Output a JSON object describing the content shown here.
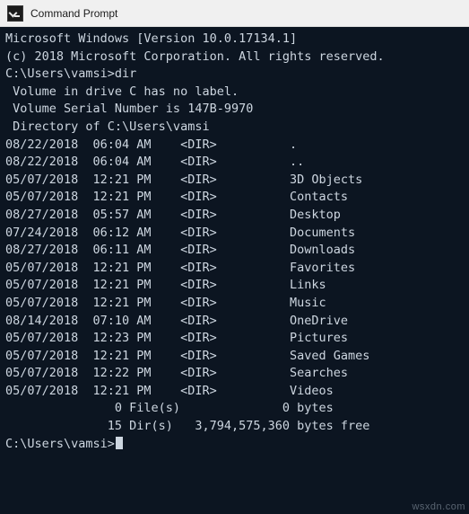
{
  "window": {
    "title": "Command Prompt",
    "icon": "command-prompt-icon",
    "background_color": "#0c1521",
    "text_color": "#cdd6e0",
    "titlebar_color": "#f0f0f0"
  },
  "console": {
    "lines": [
      "Microsoft Windows [Version 10.0.17134.1]",
      "(c) 2018 Microsoft Corporation. All rights reserved.",
      "",
      "C:\\Users\\vamsi>dir",
      " Volume in drive C has no label.",
      " Volume Serial Number is 147B-9970",
      "",
      " Directory of C:\\Users\\vamsi",
      "",
      "08/22/2018  06:04 AM    <DIR>          .",
      "08/22/2018  06:04 AM    <DIR>          ..",
      "05/07/2018  12:21 PM    <DIR>          3D Objects",
      "05/07/2018  12:21 PM    <DIR>          Contacts",
      "08/27/2018  05:57 AM    <DIR>          Desktop",
      "07/24/2018  06:12 AM    <DIR>          Documents",
      "08/27/2018  06:11 AM    <DIR>          Downloads",
      "05/07/2018  12:21 PM    <DIR>          Favorites",
      "05/07/2018  12:21 PM    <DIR>          Links",
      "05/07/2018  12:21 PM    <DIR>          Music",
      "08/14/2018  07:10 AM    <DIR>          OneDrive",
      "05/07/2018  12:23 PM    <DIR>          Pictures",
      "05/07/2018  12:21 PM    <DIR>          Saved Games",
      "05/07/2018  12:22 PM    <DIR>          Searches",
      "05/07/2018  12:21 PM    <DIR>          Videos",
      "               0 File(s)              0 bytes",
      "              15 Dir(s)   3,794,575,360 bytes free",
      "",
      "C:\\Users\\vamsi>"
    ],
    "prompt": "C:\\Users\\vamsi>",
    "cursor_visible": true
  },
  "watermark": {
    "text": "wsxdn.com"
  }
}
